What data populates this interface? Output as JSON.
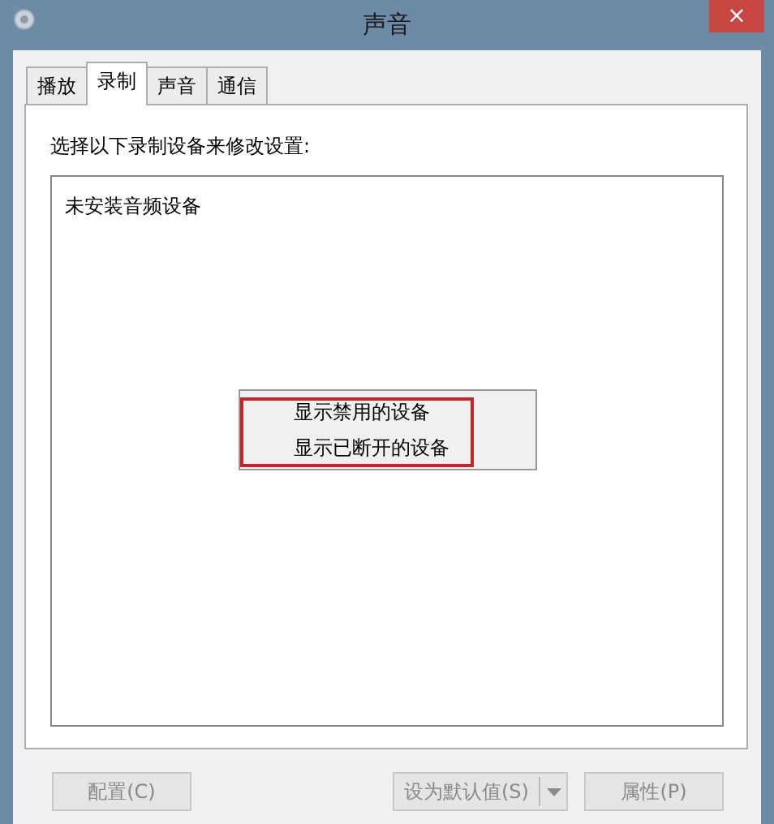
{
  "window": {
    "title": "声音",
    "close": "×"
  },
  "tabs": [
    {
      "label": "播放",
      "selected": false
    },
    {
      "label": "录制",
      "selected": true
    },
    {
      "label": "声音",
      "selected": false
    },
    {
      "label": "通信",
      "selected": false
    }
  ],
  "instruction": "选择以下录制设备来修改设置:",
  "device_list": {
    "empty_text": "未安装音频设备"
  },
  "context_menu": {
    "items": [
      {
        "label": "显示禁用的设备",
        "highlighted": true
      },
      {
        "label": "显示已断开的设备",
        "highlighted": true
      }
    ]
  },
  "buttons": [
    {
      "label": "配置(C)",
      "kind": "plain",
      "disabled": true
    },
    {
      "label": "设为默认值(S)",
      "kind": "split",
      "disabled": true
    },
    {
      "label": "属性(P)",
      "kind": "plain",
      "disabled": true
    }
  ]
}
